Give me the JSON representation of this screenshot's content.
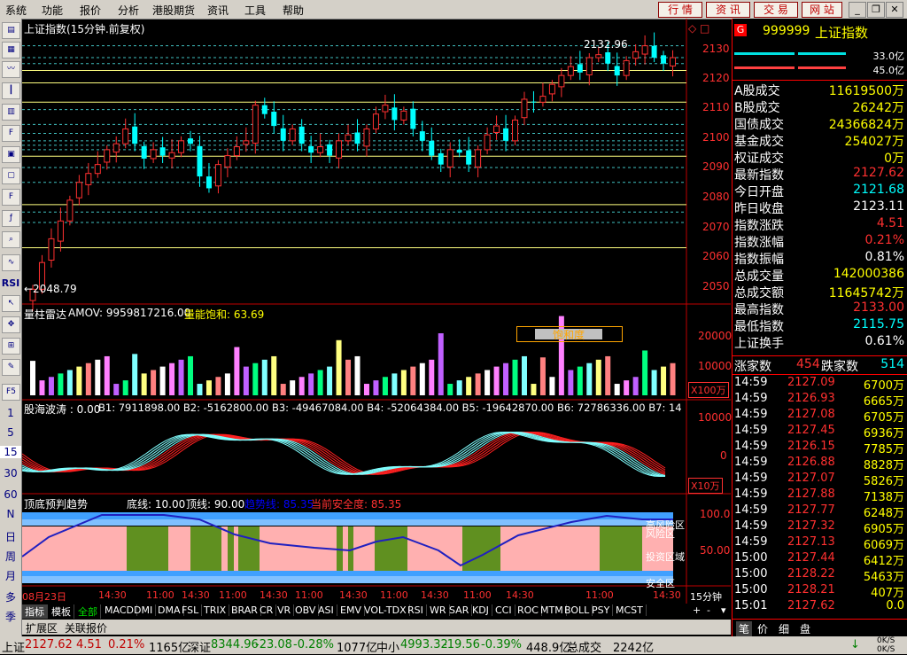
{
  "menu": [
    "系统",
    "功能",
    "报价",
    "分析",
    "港股期货",
    "资讯",
    "工具",
    "帮助"
  ],
  "top_buttons": [
    "行 情",
    "资 讯",
    "交 易",
    "网 站"
  ],
  "left_toolbar_text": [
    "RSI",
    "F5",
    "1",
    "5",
    "15",
    "30",
    "60",
    "N",
    "日",
    "周",
    "月",
    "多",
    "季"
  ],
  "chart": {
    "title": "上证指数(15分钟.前复权)",
    "high_label": "2132.96",
    "low_label": "←2048.79",
    "price_axis": [
      "2130",
      "2120",
      "2110",
      "2100",
      "2090",
      "2080",
      "2070",
      "2060",
      "2050"
    ],
    "vol_title": "量柱雷达",
    "vol_amov": "AMOV: 9959817216.00",
    "vol_sat_label": "量能饱和: 63.69",
    "vol_box": "饱和度",
    "vol_axis": [
      "20000",
      "10000"
    ],
    "vol_unit": "X100万",
    "wave_title": "股海波涛 : 0.00",
    "wave_params": "B1: 7911898.00  B2: -5162800.00  B3: -49467084.00  B4: -52064384.00  B5: -19642870.00  B6: 72786336.00  B7: 14",
    "wave_axis": [
      "10000",
      "0"
    ],
    "wave_unit": "X10万",
    "bottom_title": "顶底预判趋势",
    "bottom_base": "底线: 10.00",
    "bottom_top": "顶线: 90.00",
    "bottom_line": "趋势线: 85.35",
    "bottom_safe": "当前安全度: 85.35",
    "bottom_axis": [
      "100.0",
      "50.00"
    ],
    "zones": [
      "高风险区",
      "风险区",
      "投资区域",
      "安全区"
    ],
    "time_axis": [
      "08月23日",
      "14:30",
      "11:00",
      "14:30",
      "11:00",
      "14:30",
      "11:00",
      "14:30",
      "11:00",
      "14:30",
      "11:00",
      "14:30",
      "11:00",
      "14:30"
    ],
    "period": "15分钟"
  },
  "tabs": [
    "指标",
    "模板",
    "全部",
    "MACD",
    "DMI",
    "DMA",
    "FSL",
    "TRIX",
    "BRAR",
    "CR",
    "VR",
    "OBV",
    "ASI",
    "EMV",
    "VOL-TDX",
    "RSI",
    "WR",
    "SAR",
    "KDJ",
    "CCI",
    "ROC",
    "MTM",
    "BOLL",
    "PSY",
    "MCST"
  ],
  "tab_nav": [
    "+",
    "-"
  ],
  "tabs2": [
    "扩展区",
    "关联报价"
  ],
  "right": {
    "code": "999999",
    "name": "上证指数",
    "bar_top": "33.0亿",
    "bar_bot": "45.0亿",
    "rows": [
      {
        "k": "A股成交",
        "v": "11619500万",
        "c": "yel"
      },
      {
        "k": "B股成交",
        "v": "26242万",
        "c": "yel"
      },
      {
        "k": "国债成交",
        "v": "24366824万",
        "c": "yel"
      },
      {
        "k": "基金成交",
        "v": "254027万",
        "c": "yel"
      },
      {
        "k": "权证成交",
        "v": "0万",
        "c": "yel"
      },
      {
        "k": "最新指数",
        "v": "2127.62",
        "c": "red"
      },
      {
        "k": "今日开盘",
        "v": "2121.68",
        "c": "cyan"
      },
      {
        "k": "昨日收盘",
        "v": "2123.11",
        "c": "white"
      },
      {
        "k": "指数涨跌",
        "v": "4.51",
        "c": "red"
      },
      {
        "k": "指数涨幅",
        "v": "0.21%",
        "c": "red"
      },
      {
        "k": "指数振幅",
        "v": "0.81%",
        "c": "white"
      },
      {
        "k": "总成交量",
        "v": "142000386",
        "c": "yel"
      },
      {
        "k": "总成交额",
        "v": "11645742万",
        "c": "yel"
      },
      {
        "k": "最高指数",
        "v": "2133.00",
        "c": "red"
      },
      {
        "k": "最低指数",
        "v": "2115.75",
        "c": "cyan"
      },
      {
        "k": "上证换手",
        "v": "0.61%",
        "c": "white"
      }
    ],
    "updown_label1": "涨家数",
    "up": "454",
    "updown_label2": "跌家数",
    "down": "514",
    "ticks": [
      [
        "14:59",
        "2127.09",
        "6700万"
      ],
      [
        "14:59",
        "2126.93",
        "6665万"
      ],
      [
        "14:59",
        "2127.08",
        "6705万"
      ],
      [
        "14:59",
        "2127.45",
        "6936万"
      ],
      [
        "14:59",
        "2126.15",
        "7785万"
      ],
      [
        "14:59",
        "2126.88",
        "8828万"
      ],
      [
        "14:59",
        "2127.07",
        "5826万"
      ],
      [
        "14:59",
        "2127.88",
        "7138万"
      ],
      [
        "14:59",
        "2127.77",
        "6248万"
      ],
      [
        "14:59",
        "2127.32",
        "6905万"
      ],
      [
        "14:59",
        "2127.13",
        "6069万"
      ],
      [
        "15:00",
        "2127.44",
        "6412万"
      ],
      [
        "15:00",
        "2128.22",
        "5463万"
      ],
      [
        "15:00",
        "2128.21",
        "407万"
      ],
      [
        "15:01",
        "2127.62",
        "0.0"
      ]
    ],
    "bottom_tabs": [
      "笔",
      "价",
      "细",
      "盘"
    ],
    "speed": [
      "0K/S",
      "0K/S"
    ]
  },
  "status": {
    "sh_name": "上证",
    "sh_val": "2127.62",
    "sh_chg": "4.51",
    "sh_pct": "0.21%",
    "sh_amt": "1165亿",
    "sz_name": "深证",
    "sz_val": "8344.96",
    "sz_chg": "-23.08",
    "sz_pct": "-0.28%",
    "sz_amt": "1077亿",
    "zx_name": "中小",
    "zx_val": "4993.32",
    "zx_chg": "-19.56",
    "zx_pct": "-0.39%",
    "zx_amt": "448.9亿",
    "total_label": "总成交",
    "total": "2242亿"
  },
  "colors": {
    "up": "#ff3030",
    "down": "#00ffff",
    "panel_border": "#ff0000"
  }
}
